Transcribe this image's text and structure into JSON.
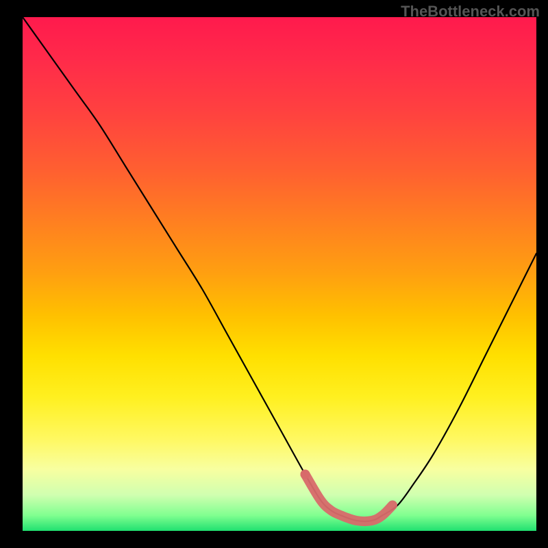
{
  "watermark": "TheBottleneck.com",
  "chart_data": {
    "type": "line",
    "title": "",
    "xlabel": "",
    "ylabel": "",
    "xlim": [
      0,
      100
    ],
    "ylim": [
      0,
      100
    ],
    "curve": {
      "x": [
        0,
        5,
        10,
        15,
        20,
        25,
        30,
        35,
        40,
        45,
        50,
        55,
        58,
        60,
        62,
        65,
        68,
        70,
        73,
        76,
        80,
        85,
        90,
        95,
        100
      ],
      "y": [
        100,
        93,
        86,
        79,
        71,
        63,
        55,
        47,
        38,
        29,
        20,
        11,
        6,
        4,
        3,
        2,
        2,
        3,
        5,
        9,
        15,
        24,
        34,
        44,
        54
      ]
    },
    "highlight_segment": {
      "x": [
        55,
        58,
        60,
        62,
        65,
        68,
        70,
        72
      ],
      "y": [
        11,
        6,
        4,
        3,
        2,
        2,
        3,
        5
      ]
    },
    "highlight_dot": {
      "x": 55,
      "y": 11
    },
    "gradient_stops": [
      {
        "pos": 0,
        "color": "#ff1a4d"
      },
      {
        "pos": 50,
        "color": "#ffa010"
      },
      {
        "pos": 75,
        "color": "#fff020"
      },
      {
        "pos": 100,
        "color": "#20e070"
      }
    ]
  }
}
